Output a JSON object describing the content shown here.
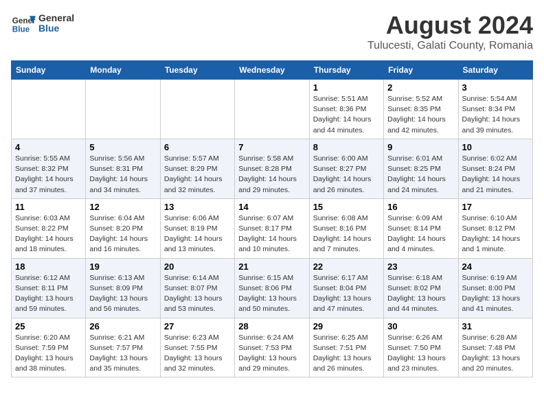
{
  "logo": {
    "line1": "General",
    "line2": "Blue"
  },
  "title": "August 2024",
  "subtitle": "Tulucesti, Galati County, Romania",
  "days_of_week": [
    "Sunday",
    "Monday",
    "Tuesday",
    "Wednesday",
    "Thursday",
    "Friday",
    "Saturday"
  ],
  "weeks": [
    [
      {
        "day": "",
        "info": ""
      },
      {
        "day": "",
        "info": ""
      },
      {
        "day": "",
        "info": ""
      },
      {
        "day": "",
        "info": ""
      },
      {
        "day": "1",
        "info": "Sunrise: 5:51 AM\nSunset: 8:36 PM\nDaylight: 14 hours and 44 minutes."
      },
      {
        "day": "2",
        "info": "Sunrise: 5:52 AM\nSunset: 8:35 PM\nDaylight: 14 hours and 42 minutes."
      },
      {
        "day": "3",
        "info": "Sunrise: 5:54 AM\nSunset: 8:34 PM\nDaylight: 14 hours and 39 minutes."
      }
    ],
    [
      {
        "day": "4",
        "info": "Sunrise: 5:55 AM\nSunset: 8:32 PM\nDaylight: 14 hours and 37 minutes."
      },
      {
        "day": "5",
        "info": "Sunrise: 5:56 AM\nSunset: 8:31 PM\nDaylight: 14 hours and 34 minutes."
      },
      {
        "day": "6",
        "info": "Sunrise: 5:57 AM\nSunset: 8:29 PM\nDaylight: 14 hours and 32 minutes."
      },
      {
        "day": "7",
        "info": "Sunrise: 5:58 AM\nSunset: 8:28 PM\nDaylight: 14 hours and 29 minutes."
      },
      {
        "day": "8",
        "info": "Sunrise: 6:00 AM\nSunset: 8:27 PM\nDaylight: 14 hours and 26 minutes."
      },
      {
        "day": "9",
        "info": "Sunrise: 6:01 AM\nSunset: 8:25 PM\nDaylight: 14 hours and 24 minutes."
      },
      {
        "day": "10",
        "info": "Sunrise: 6:02 AM\nSunset: 8:24 PM\nDaylight: 14 hours and 21 minutes."
      }
    ],
    [
      {
        "day": "11",
        "info": "Sunrise: 6:03 AM\nSunset: 8:22 PM\nDaylight: 14 hours and 18 minutes."
      },
      {
        "day": "12",
        "info": "Sunrise: 6:04 AM\nSunset: 8:20 PM\nDaylight: 14 hours and 16 minutes."
      },
      {
        "day": "13",
        "info": "Sunrise: 6:06 AM\nSunset: 8:19 PM\nDaylight: 14 hours and 13 minutes."
      },
      {
        "day": "14",
        "info": "Sunrise: 6:07 AM\nSunset: 8:17 PM\nDaylight: 14 hours and 10 minutes."
      },
      {
        "day": "15",
        "info": "Sunrise: 6:08 AM\nSunset: 8:16 PM\nDaylight: 14 hours and 7 minutes."
      },
      {
        "day": "16",
        "info": "Sunrise: 6:09 AM\nSunset: 8:14 PM\nDaylight: 14 hours and 4 minutes."
      },
      {
        "day": "17",
        "info": "Sunrise: 6:10 AM\nSunset: 8:12 PM\nDaylight: 14 hours and 1 minute."
      }
    ],
    [
      {
        "day": "18",
        "info": "Sunrise: 6:12 AM\nSunset: 8:11 PM\nDaylight: 13 hours and 59 minutes."
      },
      {
        "day": "19",
        "info": "Sunrise: 6:13 AM\nSunset: 8:09 PM\nDaylight: 13 hours and 56 minutes."
      },
      {
        "day": "20",
        "info": "Sunrise: 6:14 AM\nSunset: 8:07 PM\nDaylight: 13 hours and 53 minutes."
      },
      {
        "day": "21",
        "info": "Sunrise: 6:15 AM\nSunset: 8:06 PM\nDaylight: 13 hours and 50 minutes."
      },
      {
        "day": "22",
        "info": "Sunrise: 6:17 AM\nSunset: 8:04 PM\nDaylight: 13 hours and 47 minutes."
      },
      {
        "day": "23",
        "info": "Sunrise: 6:18 AM\nSunset: 8:02 PM\nDaylight: 13 hours and 44 minutes."
      },
      {
        "day": "24",
        "info": "Sunrise: 6:19 AM\nSunset: 8:00 PM\nDaylight: 13 hours and 41 minutes."
      }
    ],
    [
      {
        "day": "25",
        "info": "Sunrise: 6:20 AM\nSunset: 7:59 PM\nDaylight: 13 hours and 38 minutes."
      },
      {
        "day": "26",
        "info": "Sunrise: 6:21 AM\nSunset: 7:57 PM\nDaylight: 13 hours and 35 minutes."
      },
      {
        "day": "27",
        "info": "Sunrise: 6:23 AM\nSunset: 7:55 PM\nDaylight: 13 hours and 32 minutes."
      },
      {
        "day": "28",
        "info": "Sunrise: 6:24 AM\nSunset: 7:53 PM\nDaylight: 13 hours and 29 minutes."
      },
      {
        "day": "29",
        "info": "Sunrise: 6:25 AM\nSunset: 7:51 PM\nDaylight: 13 hours and 26 minutes."
      },
      {
        "day": "30",
        "info": "Sunrise: 6:26 AM\nSunset: 7:50 PM\nDaylight: 13 hours and 23 minutes."
      },
      {
        "day": "31",
        "info": "Sunrise: 6:28 AM\nSunset: 7:48 PM\nDaylight: 13 hours and 20 minutes."
      }
    ]
  ]
}
